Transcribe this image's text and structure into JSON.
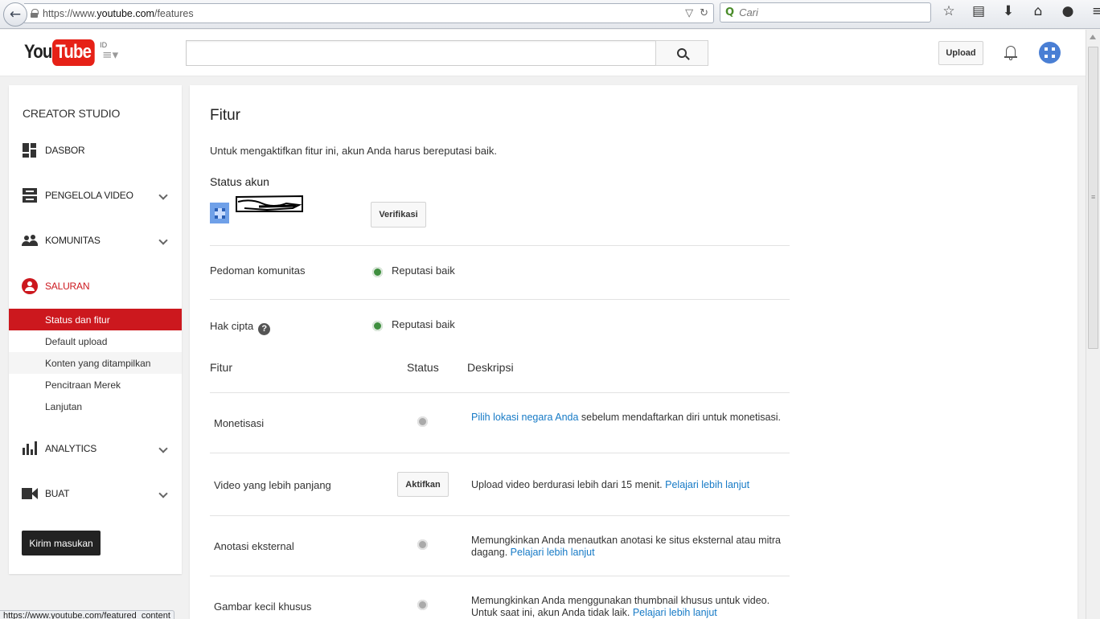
{
  "browser": {
    "url_prefix": "https://www.",
    "url_domain": "youtube.com",
    "url_path": "/features",
    "search_placeholder": "Cari",
    "status_url": "https://www.youtube.com/featured_content"
  },
  "header": {
    "logo_you": "You",
    "logo_tube": "Tube",
    "region": "ID",
    "upload_label": "Upload"
  },
  "sidebar": {
    "title": "CREATOR STUDIO",
    "items": [
      {
        "label": "DASBOR"
      },
      {
        "label": "PENGELOLA VIDEO"
      },
      {
        "label": "KOMUNITAS"
      },
      {
        "label": "SALURAN"
      },
      {
        "label": "ANALYTICS"
      },
      {
        "label": "BUAT"
      }
    ],
    "subitems": [
      {
        "label": "Status dan fitur"
      },
      {
        "label": "Default upload"
      },
      {
        "label": "Konten yang ditampilkan"
      },
      {
        "label": "Pencitraan Merek"
      },
      {
        "label": "Lanjutan"
      }
    ],
    "feedback_label": "Kirim masukan"
  },
  "main": {
    "title": "Fitur",
    "intro": "Untuk mengaktifkan fitur ini, akun Anda harus bereputasi baik.",
    "status_heading": "Status akun",
    "verify_label": "Verifikasi",
    "rows": [
      {
        "label": "Pedoman komunitas",
        "status": "Reputasi baik"
      },
      {
        "label": "Hak cipta",
        "status": "Reputasi baik"
      }
    ],
    "table_headers": {
      "feature": "Fitur",
      "status": "Status",
      "description": "Deskripsi"
    },
    "features": [
      {
        "name": "Monetisasi",
        "link": "Pilih lokasi negara Anda",
        "desc": " sebelum mendaftarkan diri untuk monetisasi."
      },
      {
        "name": "Video yang lebih panjang",
        "button": "Aktifkan",
        "desc": "Upload video berdurasi lebih dari 15 menit. ",
        "link": "Pelajari lebih lanjut"
      },
      {
        "name": "Anotasi eksternal",
        "desc": "Memungkinkan Anda menautkan anotasi ke situs eksternal atau mitra dagang. ",
        "link": "Pelajari lebih lanjut"
      },
      {
        "name": "Gambar kecil khusus",
        "desc": "Memungkinkan Anda menggunakan thumbnail khusus untuk video. Untuk saat ini, akun Anda tidak laik. ",
        "link": "Pelajari lebih lanjut"
      }
    ]
  },
  "colors": {
    "accent": "#cc181e",
    "link": "#167ac6",
    "good": "#3f8f3f"
  }
}
